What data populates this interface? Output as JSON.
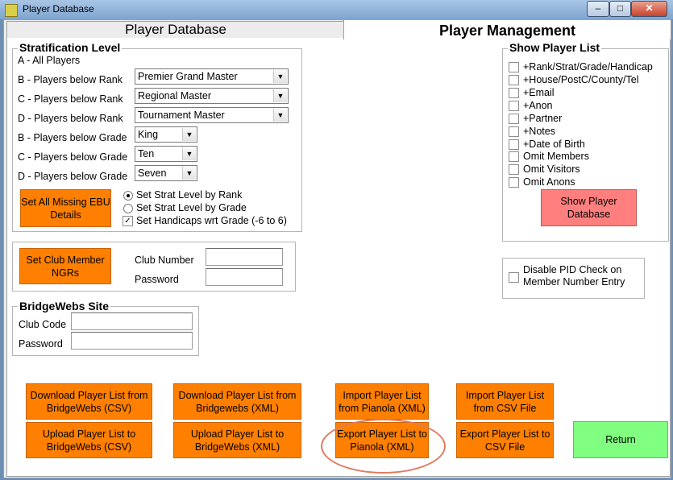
{
  "window": {
    "title": "Player Database",
    "minimize": "–",
    "maximize": "□",
    "close": "✕"
  },
  "tabs": [
    {
      "label": "Player Database"
    },
    {
      "label": "Player Management"
    }
  ],
  "stratification": {
    "legend": "Stratification Level",
    "all_players": "A - All Players",
    "rows": [
      {
        "label": "B - Players below Rank",
        "value": "Premier Grand Master"
      },
      {
        "label": "C - Players below Rank",
        "value": "Regional Master"
      },
      {
        "label": "D - Players below Rank",
        "value": "Tournament Master"
      },
      {
        "label": "B - Players below Grade",
        "value": "King"
      },
      {
        "label": "C - Players below Grade",
        "value": "Ten"
      },
      {
        "label": "D - Players below Grade",
        "value": "Seven"
      }
    ],
    "set_missing_button": "Set All Missing EBU Details",
    "radio_rank": "Set Strat Level by Rank",
    "radio_grade": "Set Strat Level by Grade",
    "handicap_check": "Set Handicaps wrt Grade (-6 to 6)",
    "handicap_checked": "✓"
  },
  "club": {
    "button": "Set Club Member NGRs",
    "club_number_label": "Club Number",
    "password_label": "Password",
    "club_number_value": "",
    "password_value": ""
  },
  "bridgewebs": {
    "legend": "BridgeWebs Site",
    "club_code_label": "Club Code",
    "password_label": "Password",
    "club_code_value": "",
    "password_value": ""
  },
  "show_list": {
    "legend": "Show Player List",
    "options": [
      "+Rank/Strat/Grade/Handicap",
      "+House/PostC/County/Tel",
      "+Email",
      "+Anon",
      "+Partner",
      "+Notes",
      "+Date of Birth",
      "Omit Members",
      "Omit Visitors",
      "Omit Anons"
    ],
    "button": "Show Player Database"
  },
  "pid_check": {
    "label": "Disable PID Check on Member Number Entry"
  },
  "actions": {
    "download_csv": "Download Player List from BridgeWebs (CSV)",
    "download_xml": "Download Player List from Bridgewebs (XML)",
    "import_pianola": "Import Player List from Pianola (XML)",
    "import_csv": "Import Player List from CSV File",
    "upload_csv": "Upload Player List to BridgeWebs (CSV)",
    "upload_xml": "Upload Player List to BridgeWebs (XML)",
    "export_pianola": "Export Player List to Pianola (XML)",
    "export_csv": "Export Player List to CSV File",
    "return": "Return"
  },
  "colors": {
    "orange": "#ff8000",
    "pink": "#ff7f7f",
    "green": "#80ff80",
    "highlight": "#e07b5e"
  }
}
